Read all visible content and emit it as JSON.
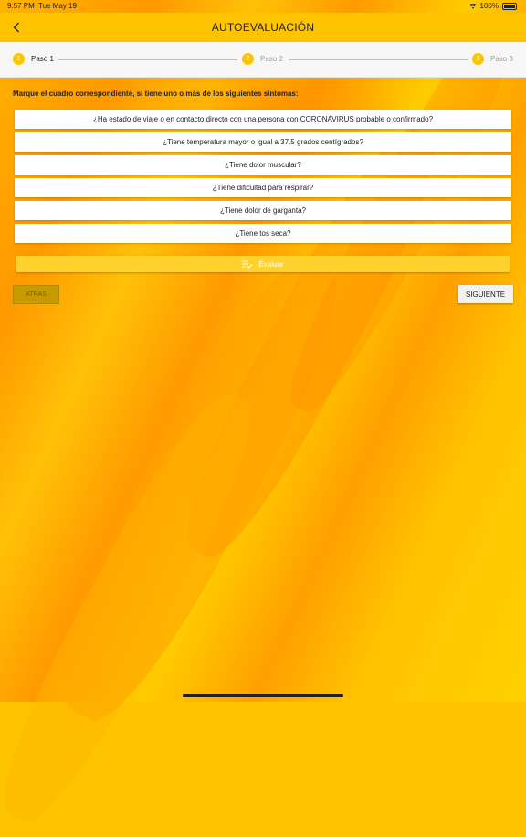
{
  "status_bar": {
    "time": "9:57 PM",
    "date": "Tue May 19",
    "battery": "100%"
  },
  "header": {
    "title": "AUTOEVALUACIÓN"
  },
  "stepper": {
    "steps": [
      {
        "number": "1",
        "label": "Paso 1"
      },
      {
        "number": "2",
        "label": "Paso 2"
      },
      {
        "number": "3",
        "label": "Paso 3"
      }
    ]
  },
  "instruction": "Marque el cuadro correspondiente, si tiene uno o más de los siguientes síntomas:",
  "questions": [
    "¿Ha estado de viaje o en contacto directo con una persona con CORONAVIRUS probable o confirmado?",
    "¿Tiene temperatura mayor o igual a 37.5 grados centígrados?",
    "¿Tiene dolor muscular?",
    "¿Tiene dificultad para respirar?",
    "¿Tiene dolor de garganta?",
    "¿Tiene tos seca?"
  ],
  "evaluate_label": "Evaluar",
  "nav": {
    "back_label": "ATRAS",
    "next_label": "SIGUIENTE"
  },
  "colors": {
    "primary": "#FFC400",
    "accent": "#FF9900",
    "text": "#222222"
  }
}
